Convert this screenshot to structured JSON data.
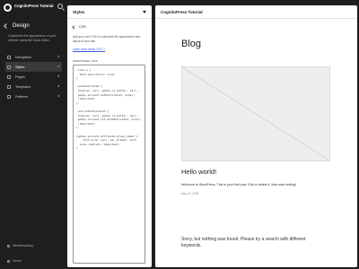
{
  "sidebar": {
    "site_title": "CognitoPress Tutorial",
    "section_title": "Design",
    "description": "Customize the appearance of your website using the block editor.",
    "items": [
      {
        "label": "Navigation"
      },
      {
        "label": "Styles"
      },
      {
        "label": "Pages"
      },
      {
        "label": "Templates"
      },
      {
        "label": "Patterns"
      }
    ],
    "footer_item": "Whiteboarding",
    "footer_save": "Saved"
  },
  "styles_panel": {
    "title": "Styles",
    "subtitle": "CSS",
    "description": "Add your own CSS to customize the appearance and layout of your site.",
    "learn_link": "Learn more about CSS ↗",
    "additional_label": "ADDITIONAL CSS",
    "css_code": ".link a {\n  text-decoration: none;\n}\n\n.authenticated {\n display: var(--gatey-is-editor, var(--\n gatey-account-authenticated, none))\n !important;\n}\n\n.not-authenticated {\n display: var(--gatey-is-editor, var(--\n gatey-account-not-authenticated, none))\n !important;\n}\n\n[gatey-account-attribute-given_name] {\n    font-size: var(--wp--preset--font-\n  size--medium) !important;\n}"
  },
  "preview": {
    "title": "CognitoPress Tutorial",
    "blog_title": "Blog",
    "post_title": "Hello world!",
    "post_body": "Welcome to WordPress. This is your first post. Edit or delete it, then start writing!",
    "post_date": "May 22, 2024",
    "not_found": "Sorry, but nothing was found. Please try a search with different keywords."
  }
}
